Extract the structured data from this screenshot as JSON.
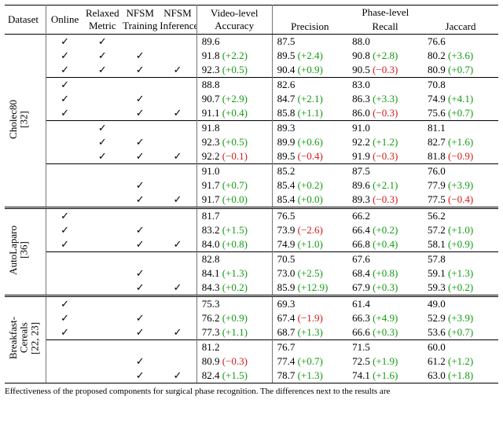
{
  "columns": {
    "dataset": "Dataset",
    "online": "Online",
    "relaxed": "Relaxed Metric",
    "train": "NFSM Training",
    "infer": "NFSM Inference",
    "acc": "Video-level Accuracy",
    "phase_group": "Phase-level",
    "prec": "Precision",
    "rec": "Recall",
    "jac": "Jaccard"
  },
  "check": "✓",
  "datasets": [
    {
      "name": "Cholec80 [32]",
      "blocks": [
        {
          "cfg": [
            [
              true,
              true,
              false,
              false
            ],
            [
              true,
              true,
              true,
              false
            ],
            [
              true,
              true,
              true,
              true
            ]
          ],
          "vals": [
            [
              {
                "v": "89.6"
              },
              {
                "v": "87.5"
              },
              {
                "v": "88.0"
              },
              {
                "v": "76.6"
              }
            ],
            [
              {
                "v": "91.8",
                "d": "+2.2",
                "s": "pos"
              },
              {
                "v": "89.5",
                "d": "+2.4",
                "s": "pos"
              },
              {
                "v": "90.8",
                "d": "+2.8",
                "s": "pos"
              },
              {
                "v": "80.2",
                "d": "+3.6",
                "s": "pos"
              }
            ],
            [
              {
                "v": "92.3",
                "d": "+0.5",
                "s": "pos"
              },
              {
                "v": "90.4",
                "d": "+0.9",
                "s": "pos"
              },
              {
                "v": "90.5",
                "d": "−0.3",
                "s": "neg"
              },
              {
                "v": "80.9",
                "d": "+0.7",
                "s": "pos"
              }
            ]
          ]
        },
        {
          "cfg": [
            [
              true,
              false,
              false,
              false
            ],
            [
              true,
              false,
              true,
              false
            ],
            [
              true,
              false,
              true,
              true
            ]
          ],
          "vals": [
            [
              {
                "v": "88.8"
              },
              {
                "v": "82.6"
              },
              {
                "v": "83.0"
              },
              {
                "v": "70.8"
              }
            ],
            [
              {
                "v": "90.7",
                "d": "+2.9",
                "s": "pos"
              },
              {
                "v": "84.7",
                "d": "+2.1",
                "s": "pos"
              },
              {
                "v": "86.3",
                "d": "+3.3",
                "s": "pos"
              },
              {
                "v": "74.9",
                "d": "+4.1",
                "s": "pos"
              }
            ],
            [
              {
                "v": "91.1",
                "d": "+0.4",
                "s": "pos"
              },
              {
                "v": "85.8",
                "d": "+1.1",
                "s": "pos"
              },
              {
                "v": "86.0",
                "d": "−0.3",
                "s": "neg"
              },
              {
                "v": "75.6",
                "d": "+0.7",
                "s": "pos"
              }
            ]
          ]
        },
        {
          "cfg": [
            [
              false,
              true,
              false,
              false
            ],
            [
              false,
              true,
              true,
              false
            ],
            [
              false,
              true,
              true,
              true
            ]
          ],
          "vals": [
            [
              {
                "v": "91.8"
              },
              {
                "v": "89.3"
              },
              {
                "v": "91.0"
              },
              {
                "v": "81.1"
              }
            ],
            [
              {
                "v": "92.3",
                "d": "+0.5",
                "s": "pos"
              },
              {
                "v": "89.9",
                "d": "+0.6",
                "s": "pos"
              },
              {
                "v": "92.2",
                "d": "+1.2",
                "s": "pos"
              },
              {
                "v": "82.7",
                "d": "+1.6",
                "s": "pos"
              }
            ],
            [
              {
                "v": "92.2",
                "d": "−0.1",
                "s": "neg"
              },
              {
                "v": "89.5",
                "d": "−0.4",
                "s": "neg"
              },
              {
                "v": "91.9",
                "d": "−0.3",
                "s": "neg"
              },
              {
                "v": "81.8",
                "d": "−0.9",
                "s": "neg"
              }
            ]
          ]
        },
        {
          "cfg": [
            [
              false,
              false,
              false,
              false
            ],
            [
              false,
              false,
              true,
              false
            ],
            [
              false,
              false,
              true,
              true
            ]
          ],
          "vals": [
            [
              {
                "v": "91.0"
              },
              {
                "v": "85.2"
              },
              {
                "v": "87.5"
              },
              {
                "v": "76.0"
              }
            ],
            [
              {
                "v": "91.7",
                "d": "+0.7",
                "s": "pos"
              },
              {
                "v": "85.4",
                "d": "+0.2",
                "s": "pos"
              },
              {
                "v": "89.6",
                "d": "+2.1",
                "s": "pos"
              },
              {
                "v": "77.9",
                "d": "+3.9",
                "s": "pos"
              }
            ],
            [
              {
                "v": "91.7",
                "d": "+0.0",
                "s": "pos"
              },
              {
                "v": "85.4",
                "d": "+0.0",
                "s": "pos"
              },
              {
                "v": "89.3",
                "d": "−0.3",
                "s": "neg"
              },
              {
                "v": "77.5",
                "d": "−0.4",
                "s": "neg"
              }
            ]
          ]
        }
      ]
    },
    {
      "name": "AutoLaparo [36]",
      "blocks": [
        {
          "cfg": [
            [
              true,
              false,
              false,
              false
            ],
            [
              true,
              false,
              true,
              false
            ],
            [
              true,
              false,
              true,
              true
            ]
          ],
          "vals": [
            [
              {
                "v": "81.7"
              },
              {
                "v": "76.5"
              },
              {
                "v": "66.2"
              },
              {
                "v": "56.2"
              }
            ],
            [
              {
                "v": "83.2",
                "d": "+1.5",
                "s": "pos"
              },
              {
                "v": "73.9",
                "d": "−2.6",
                "s": "neg"
              },
              {
                "v": "66.4",
                "d": "+0.2",
                "s": "pos"
              },
              {
                "v": "57.2",
                "d": "+1.0",
                "s": "pos"
              }
            ],
            [
              {
                "v": "84.0",
                "d": "+0.8",
                "s": "pos"
              },
              {
                "v": "74.9",
                "d": "+1.0",
                "s": "pos"
              },
              {
                "v": "66.8",
                "d": "+0.4",
                "s": "pos"
              },
              {
                "v": "58.1",
                "d": "+0.9",
                "s": "pos"
              }
            ]
          ]
        },
        {
          "cfg": [
            [
              false,
              false,
              false,
              false
            ],
            [
              false,
              false,
              true,
              false
            ],
            [
              false,
              false,
              true,
              true
            ]
          ],
          "vals": [
            [
              {
                "v": "82.8"
              },
              {
                "v": "70.5"
              },
              {
                "v": "67.6"
              },
              {
                "v": "57.8"
              }
            ],
            [
              {
                "v": "84.1",
                "d": "+1.3",
                "s": "pos"
              },
              {
                "v": "73.0",
                "d": "+2.5",
                "s": "pos"
              },
              {
                "v": "68.4",
                "d": "+0.8",
                "s": "pos"
              },
              {
                "v": "59.1",
                "d": "+1.3",
                "s": "pos"
              }
            ],
            [
              {
                "v": "84.3",
                "d": "+0.2",
                "s": "pos"
              },
              {
                "v": "85.9",
                "d": "+12.9",
                "s": "pos"
              },
              {
                "v": "67.9",
                "d": "+0.3",
                "s": "pos"
              },
              {
                "v": "59.3",
                "d": "+0.2",
                "s": "pos"
              }
            ]
          ]
        }
      ]
    },
    {
      "name": "Breakfast- Cereals [22, 23]",
      "blocks": [
        {
          "cfg": [
            [
              true,
              false,
              false,
              false
            ],
            [
              true,
              false,
              true,
              false
            ],
            [
              true,
              false,
              true,
              true
            ]
          ],
          "vals": [
            [
              {
                "v": "75.3"
              },
              {
                "v": "69.3"
              },
              {
                "v": "61.4"
              },
              {
                "v": "49.0"
              }
            ],
            [
              {
                "v": "76.2",
                "d": "+0.9",
                "s": "pos"
              },
              {
                "v": "67.4",
                "d": "−1.9",
                "s": "neg"
              },
              {
                "v": "66.3",
                "d": "+4.9",
                "s": "pos"
              },
              {
                "v": "52.9",
                "d": "+3.9",
                "s": "pos"
              }
            ],
            [
              {
                "v": "77.3",
                "d": "+1.1",
                "s": "pos"
              },
              {
                "v": "68.7",
                "d": "+1.3",
                "s": "pos"
              },
              {
                "v": "66.6",
                "d": "+0.3",
                "s": "pos"
              },
              {
                "v": "53.6",
                "d": "+0.7",
                "s": "pos"
              }
            ]
          ]
        },
        {
          "cfg": [
            [
              false,
              false,
              false,
              false
            ],
            [
              false,
              false,
              true,
              false
            ],
            [
              false,
              false,
              true,
              true
            ]
          ],
          "vals": [
            [
              {
                "v": "81.2"
              },
              {
                "v": "76.7"
              },
              {
                "v": "71.5"
              },
              {
                "v": "60.0"
              }
            ],
            [
              {
                "v": "80.9",
                "d": "−0.3",
                "s": "neg"
              },
              {
                "v": "77.4",
                "d": "+0.7",
                "s": "pos"
              },
              {
                "v": "72.5",
                "d": "+1.9",
                "s": "pos"
              },
              {
                "v": "61.2",
                "d": "+1.2",
                "s": "pos"
              }
            ],
            [
              {
                "v": "82.4",
                "d": "+1.5",
                "s": "pos"
              },
              {
                "v": "78.7",
                "d": "+1.3",
                "s": "pos"
              },
              {
                "v": "74.1",
                "d": "+1.6",
                "s": "pos"
              },
              {
                "v": "63.0",
                "d": "+1.8",
                "s": "pos"
              }
            ]
          ]
        }
      ]
    }
  ],
  "caption_prefix": "Effectiveness of the proposed components for surgical phase recognition. The differences next to the results are"
}
